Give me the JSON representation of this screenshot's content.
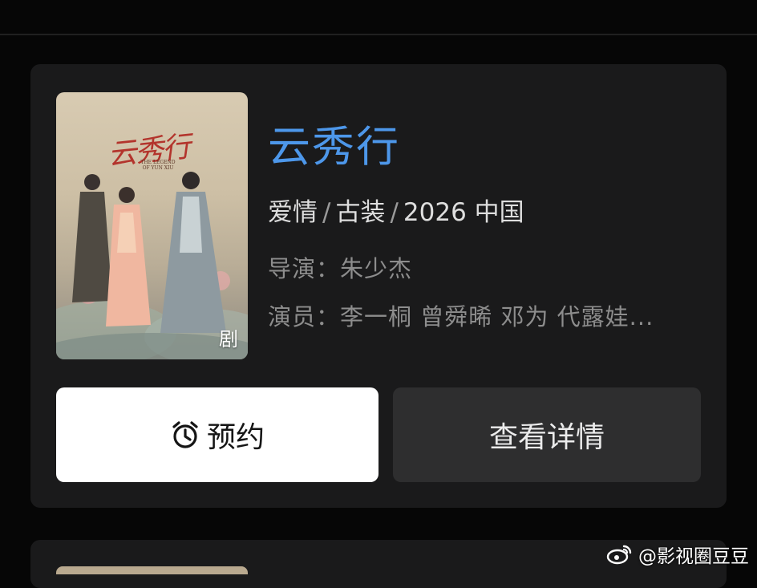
{
  "show": {
    "title": "云秀行",
    "genre1": "爱情",
    "genre2": "古装",
    "year_region": "2026 中国",
    "director_label": "导演：",
    "director": "朱少杰",
    "cast_label": "演员：",
    "cast": "李一桐 曾舜晞 邓为 代露娃..."
  },
  "poster": {
    "title_text": "云秀行",
    "subtitle_text": "THE LEGEND OF YUN XIU",
    "badge": "剧"
  },
  "actions": {
    "reserve_label": "预约",
    "detail_label": "查看详情"
  },
  "watermark": {
    "text": "@影视圈豆豆",
    "icon": "weibo-icon"
  },
  "colors": {
    "background": "#060606",
    "card": "#1a1a1b",
    "title_accent": "#4d97ea",
    "reserve_button": "#ffffff",
    "detail_button": "#2e2e2f"
  }
}
